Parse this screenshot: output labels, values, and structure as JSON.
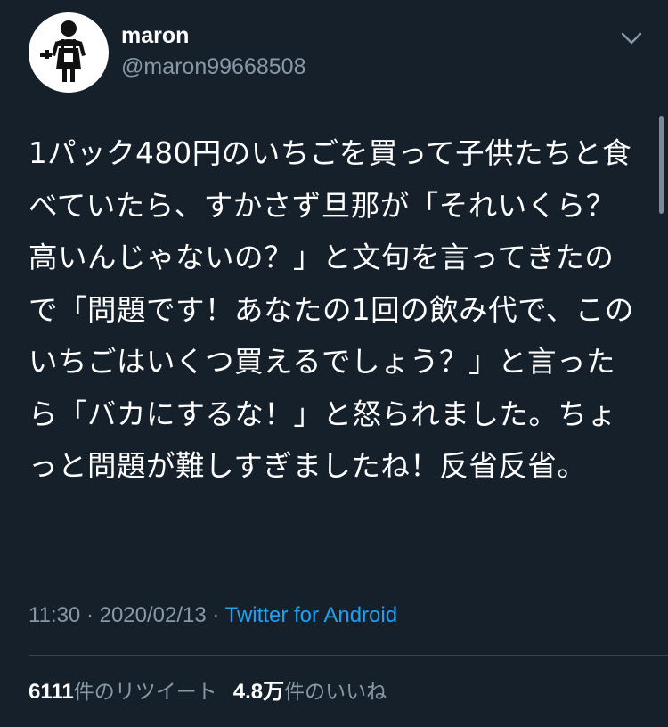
{
  "user": {
    "display_name": "maron",
    "handle": "@maron99668508",
    "avatar_icon": "chef-figure-icon"
  },
  "tweet": {
    "text": "1パック480円のいちごを買って子供たちと食べていたら、すかさず旦那が「それいくら？高いんじゃないの？」と文句を言ってきたので「問題です！あなたの1回の飲み代で、このいちごはいくつ買えるでしょう？」と言ったら「バカにするな！」と怒られました。ちょっと問題が難しすぎましたね！反省反省。",
    "time": "11:30",
    "date": "2020/02/13",
    "separator": " · ",
    "source": "Twitter for Android"
  },
  "stats": {
    "retweets_count": "6111",
    "retweets_label": "件のリツイート",
    "likes_count": "4.8万",
    "likes_label": "件のいいね"
  },
  "colors": {
    "background": "#15202b",
    "text": "#ffffff",
    "secondary": "#8899a6",
    "accent": "#1da1f2",
    "divider": "#38444d"
  },
  "icons": {
    "menu": "chevron-down-icon"
  }
}
